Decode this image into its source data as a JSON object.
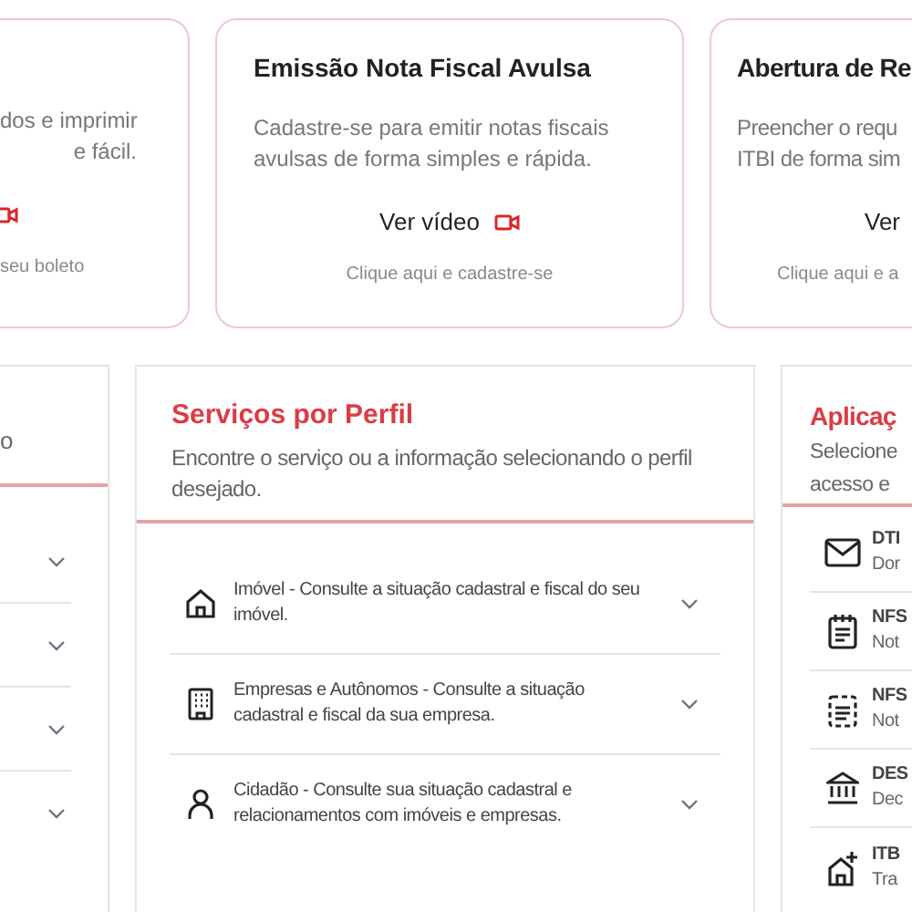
{
  "service_cards": [
    {
      "description": [
        "dos e imprimir",
        "e fácil."
      ],
      "link": "seu boleto"
    },
    {
      "title": "Emissão Nota Fiscal Avulsa",
      "description": [
        "Cadastre-se para emitir notas fiscais",
        "avulsas de forma simples e rápida."
      ],
      "video_label": "Ver vídeo",
      "link": "Clique aqui e cadastre-se"
    },
    {
      "title": "Abertura de Re",
      "description": [
        "Preencher o requ",
        "ITBI de forma sim"
      ],
      "video_label": "Ver",
      "link": "Clique aqui e a"
    }
  ],
  "left_panel": {
    "description": "o",
    "items": [
      {
        "expanded": false
      },
      {
        "expanded": false
      },
      {
        "expanded": false
      },
      {
        "expanded": false
      }
    ]
  },
  "profile_panel": {
    "title": "Serviços por Perfil",
    "description": "Encontre o serviço ou a informação selecionando o perfil desejado.",
    "items": [
      {
        "kind": "house",
        "text": "Imóvel - Consulte a situação cadastral e fiscal do seu imóvel.",
        "expanded": false
      },
      {
        "kind": "building",
        "text": "Empresas e Autônomos - Consulte a situação cadastral e fiscal da sua empresa.",
        "expanded": false
      },
      {
        "kind": "person",
        "text": "Cidadão - Consulte sua situação cadastral e relacionamentos com imóveis e empresas.",
        "expanded": false
      }
    ]
  },
  "apps_panel": {
    "title": "Aplicaç",
    "description": [
      "Selecione",
      "acesso e"
    ],
    "items": [
      {
        "kind": "mail",
        "name": "DTI",
        "subtitle": "Dor"
      },
      {
        "kind": "notepad",
        "name": "NFS",
        "subtitle": "Not"
      },
      {
        "kind": "dashed-notepad",
        "name": "NFS",
        "subtitle": "Not"
      },
      {
        "kind": "bank",
        "name": "DES",
        "subtitle": "Dec"
      },
      {
        "kind": "house-plus",
        "name": "ITB",
        "subtitle": "Tra"
      }
    ]
  }
}
